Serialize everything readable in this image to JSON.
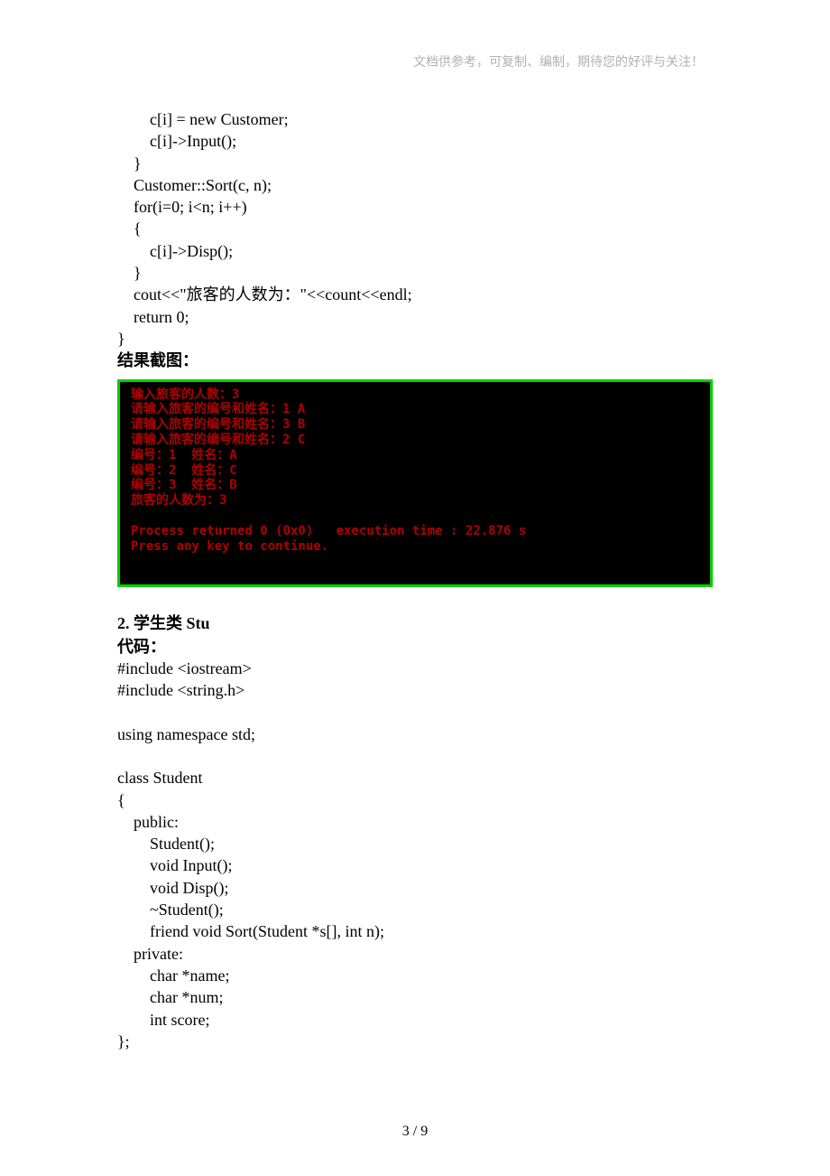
{
  "header_note": "文档供参考，可复制、编制，期待您的好评与关注！",
  "code_block_1": [
    "        c[i] = new Customer;",
    "        c[i]->Input();",
    "    }",
    "    Customer::Sort(c, n);",
    "    for(i=0; i<n; i++)",
    "    {",
    "        c[i]->Disp();",
    "    }",
    "    cout<<\"旅客的人数为：\"<<count<<endl;",
    "    return 0;",
    "}"
  ],
  "result_label": "结果截图：",
  "console": [
    "输入旅客的人数：3",
    "请输入旅客的编号和姓名：1 A",
    "请输入旅客的编号和姓名：3 B",
    "请输入旅客的编号和姓名：2 C",
    "编号：1  姓名：A",
    "编号：2  姓名：C",
    "编号：3  姓名：B",
    "旅客的人数为：3",
    "",
    "Process returned 0 (0x0)   execution time : 22.876 s",
    "Press any key to continue."
  ],
  "section2_title": "2.  学生类 Stu",
  "code_label": "代码：",
  "code_block_2": [
    "#include <iostream>",
    "#include <string.h>",
    "",
    "using namespace std;",
    "",
    "class Student",
    "{",
    "    public:",
    "        Student();",
    "        void Input();",
    "        void Disp();",
    "        ~Student();",
    "        friend void Sort(Student *s[], int n);",
    "    private:",
    "        char *name;",
    "        char *num;",
    "        int score;",
    "};"
  ],
  "page_number": "3 / 9"
}
